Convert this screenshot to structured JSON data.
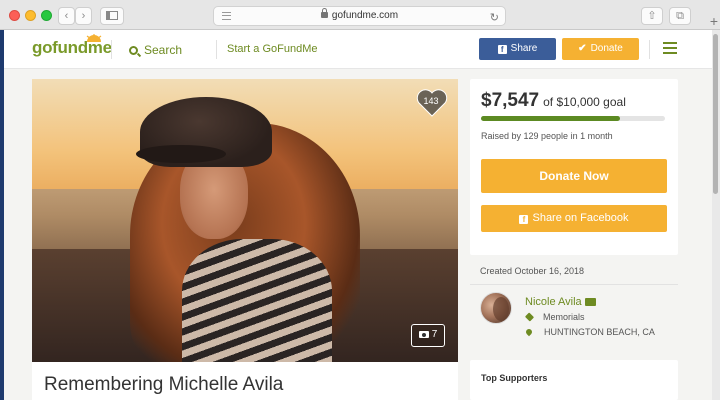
{
  "browser": {
    "url": "gofundme.com"
  },
  "nav": {
    "logo": "gofundme",
    "search_label": "Search",
    "start_label": "Start a GoFundMe",
    "share_label": "Share",
    "donate_label": "Donate"
  },
  "campaign": {
    "title": "Remembering Michelle Avila",
    "hearts": "143",
    "photo_count": "7",
    "amount": "$7,547",
    "goal": "of $10,000 goal",
    "progress": 0.7547,
    "raised_text": "Raised by 129 people in 1 month",
    "donate_now": "Donate Now",
    "share_facebook": "Share on Facebook",
    "created": "Created October 16, 2018",
    "organizer": "Nicole Avila",
    "category": "Memorials",
    "location": "HUNTINGTON BEACH, CA",
    "top_supporters": "Top Supporters"
  },
  "colors": {
    "brand_green": "#6e8b22",
    "donate_orange": "#f5b132",
    "facebook_blue": "#3b5d99"
  }
}
